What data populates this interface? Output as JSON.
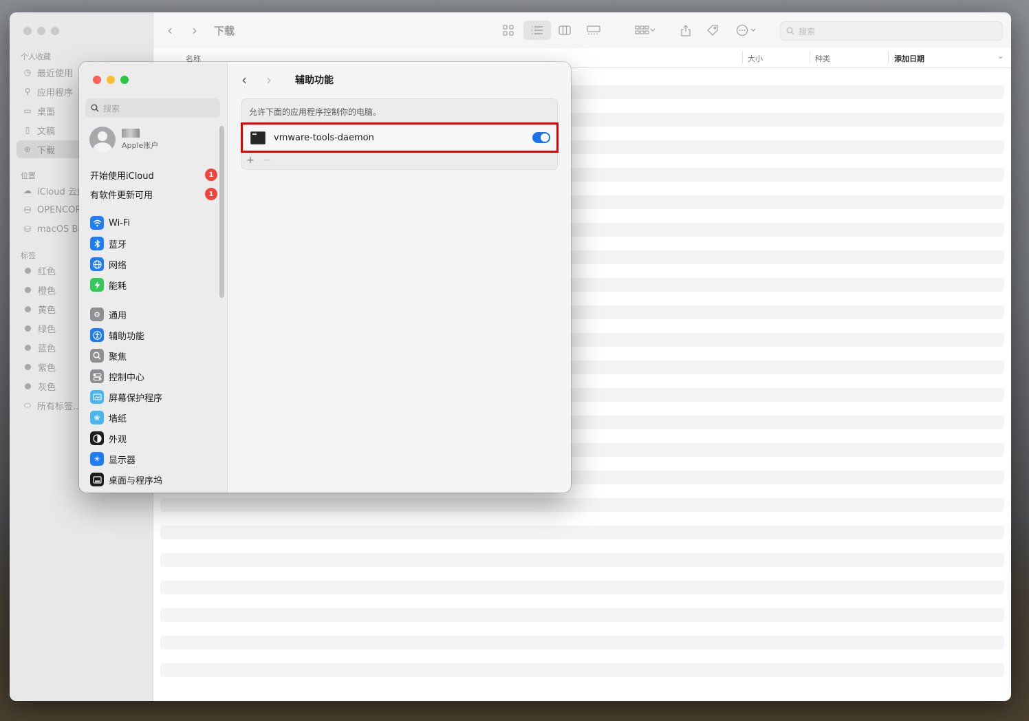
{
  "finder": {
    "title": "下载",
    "search_placeholder": "搜索",
    "sidebar": {
      "favorites_header": "个人收藏",
      "favorites": [
        {
          "label": "最近使用",
          "icon": "clock-icon"
        },
        {
          "label": "应用程序",
          "icon": "apps-icon"
        },
        {
          "label": "桌面",
          "icon": "desktop-icon"
        },
        {
          "label": "文稿",
          "icon": "document-icon"
        },
        {
          "label": "下载",
          "icon": "download-icon"
        }
      ],
      "locations_header": "位置",
      "locations": [
        {
          "label": "iCloud 云盘",
          "icon": "cloud-icon"
        },
        {
          "label": "OPENCORE",
          "icon": "disk-icon"
        },
        {
          "label": "macOS Ba",
          "icon": "disk-icon"
        }
      ],
      "tags_header": "标签",
      "tags": [
        {
          "label": "红色"
        },
        {
          "label": "橙色"
        },
        {
          "label": "黄色"
        },
        {
          "label": "绿色"
        },
        {
          "label": "蓝色"
        },
        {
          "label": "紫色"
        },
        {
          "label": "灰色"
        },
        {
          "label": "所有标签..."
        }
      ]
    },
    "columns": {
      "name": "名称",
      "size": "大小",
      "kind": "种类",
      "date_added": "添加日期"
    }
  },
  "settings": {
    "search_placeholder": "搜索",
    "user": {
      "name": "",
      "subtitle": "Apple账户"
    },
    "notices": [
      {
        "label": "开始使用iCloud",
        "badge": "1"
      },
      {
        "label": "有软件更新可用",
        "badge": "1"
      }
    ],
    "items_group1": [
      {
        "label": "Wi-Fi",
        "icon": "wifi-icon",
        "color": "#1f7cf5"
      },
      {
        "label": "蓝牙",
        "icon": "bluetooth-icon",
        "color": "#1f7cf5"
      },
      {
        "label": "网络",
        "icon": "globe-icon",
        "color": "#1f7cf5"
      },
      {
        "label": "能耗",
        "icon": "battery-icon",
        "color": "#34c759"
      }
    ],
    "items_group2": [
      {
        "label": "通用",
        "icon": "gear-icon",
        "color": "#8e8e93"
      },
      {
        "label": "辅助功能",
        "icon": "accessibility-icon",
        "color": "#1f7cf5"
      },
      {
        "label": "聚焦",
        "icon": "spotlight-icon",
        "color": "#8e8e93"
      },
      {
        "label": "控制中心",
        "icon": "control-center-icon",
        "color": "#8e8e93"
      },
      {
        "label": "屏幕保护程序",
        "icon": "screensaver-icon",
        "color": "#4ab6f0"
      },
      {
        "label": "墙纸",
        "icon": "wallpaper-icon",
        "color": "#4ab6f0"
      },
      {
        "label": "外观",
        "icon": "appearance-icon",
        "color": "#1c1c1e"
      },
      {
        "label": "显示器",
        "icon": "display-icon",
        "color": "#1f7cf5"
      },
      {
        "label": "桌面与程序坞",
        "icon": "dock-icon",
        "color": "#1c1c1e"
      }
    ],
    "pane": {
      "title": "辅助功能",
      "description": "允许下面的应用程序控制你的电脑。",
      "apps": [
        {
          "name": "vmware-tools-daemon",
          "enabled": true
        }
      ],
      "add_label": "+",
      "remove_label": "−"
    }
  },
  "colors": {
    "accent": "#1a73e8",
    "highlight_box": "#e60000",
    "badge": "#f0443a"
  }
}
